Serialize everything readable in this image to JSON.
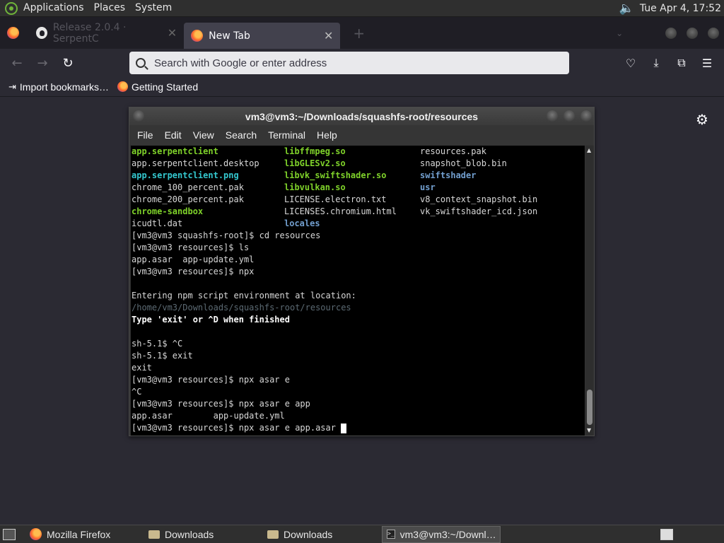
{
  "top_panel": {
    "menus": [
      "Applications",
      "Places",
      "System"
    ],
    "clock": "Tue Apr  4, 17:52"
  },
  "browser": {
    "tabs": [
      {
        "label": "Release 2.0.4 · SerpentC",
        "active": false
      },
      {
        "label": "New Tab",
        "active": true
      }
    ],
    "url_placeholder": "Search with Google or enter address",
    "bookmarks": [
      {
        "label": "Import bookmarks…",
        "icon": "import-icon"
      },
      {
        "label": "Getting Started",
        "icon": "firefox-icon"
      }
    ]
  },
  "terminal": {
    "title": "vm3@vm3:~/Downloads/squashfs-root/resources",
    "menus": [
      "File",
      "Edit",
      "View",
      "Search",
      "Terminal",
      "Help"
    ],
    "listing": [
      [
        {
          "t": "app.serpentclient",
          "c": "grn"
        },
        {
          "t": "libffmpeg.so",
          "c": "grn"
        },
        {
          "t": "resources.pak",
          "c": ""
        }
      ],
      [
        {
          "t": "app.serpentclient.desktop",
          "c": ""
        },
        {
          "t": "libGLESv2.so",
          "c": "grn"
        },
        {
          "t": "snapshot_blob.bin",
          "c": ""
        }
      ],
      [
        {
          "t": "app.serpentclient.png",
          "c": "cyn"
        },
        {
          "t": "libvk_swiftshader.so",
          "c": "grn"
        },
        {
          "t": "swiftshader",
          "c": "blu"
        }
      ],
      [
        {
          "t": "chrome_100_percent.pak",
          "c": ""
        },
        {
          "t": "libvulkan.so",
          "c": "grn"
        },
        {
          "t": "usr",
          "c": "blu"
        }
      ],
      [
        {
          "t": "chrome_200_percent.pak",
          "c": ""
        },
        {
          "t": "LICENSE.electron.txt",
          "c": ""
        },
        {
          "t": "v8_context_snapshot.bin",
          "c": ""
        }
      ],
      [
        {
          "t": "chrome-sandbox",
          "c": "grn"
        },
        {
          "t": "LICENSES.chromium.html",
          "c": ""
        },
        {
          "t": "vk_swiftshader_icd.json",
          "c": ""
        }
      ],
      [
        {
          "t": "icudtl.dat",
          "c": ""
        },
        {
          "t": "locales",
          "c": "blu"
        },
        {
          "t": "",
          "c": ""
        }
      ]
    ],
    "lines": [
      {
        "t": "[vm3@vm3 squashfs-root]$ cd resources",
        "c": ""
      },
      {
        "t": "[vm3@vm3 resources]$ ls",
        "c": ""
      },
      {
        "t": "app.asar  app-update.yml",
        "c": ""
      },
      {
        "t": "[vm3@vm3 resources]$ npx",
        "c": ""
      },
      {
        "t": "",
        "c": ""
      },
      {
        "t": "Entering npm script environment at location:",
        "c": ""
      },
      {
        "t": "/home/vm3/Downloads/squashfs-root/resources",
        "c": "dim"
      },
      {
        "t": "Type 'exit' or ^D when finished",
        "c": "bold"
      },
      {
        "t": "",
        "c": ""
      },
      {
        "t": "sh-5.1$ ^C",
        "c": ""
      },
      {
        "t": "sh-5.1$ exit",
        "c": ""
      },
      {
        "t": "exit",
        "c": ""
      },
      {
        "t": "[vm3@vm3 resources]$ npx asar e",
        "c": ""
      },
      {
        "t": "^C",
        "c": ""
      },
      {
        "t": "[vm3@vm3 resources]$ npx asar e app",
        "c": ""
      },
      {
        "t": "app.asar        app-update.yml",
        "c": ""
      },
      {
        "t": "[vm3@vm3 resources]$ npx asar e app.asar ",
        "c": "",
        "cursor": true
      }
    ]
  },
  "taskbar": {
    "items": [
      {
        "label": "Mozilla Firefox",
        "icon": "firefox-icon",
        "active": false
      },
      {
        "label": "Downloads",
        "icon": "folder-icon",
        "active": false
      },
      {
        "label": "Downloads",
        "icon": "folder-icon",
        "active": false
      },
      {
        "label": "vm3@vm3:~/Downl…",
        "icon": "terminal-icon",
        "active": true
      }
    ]
  }
}
